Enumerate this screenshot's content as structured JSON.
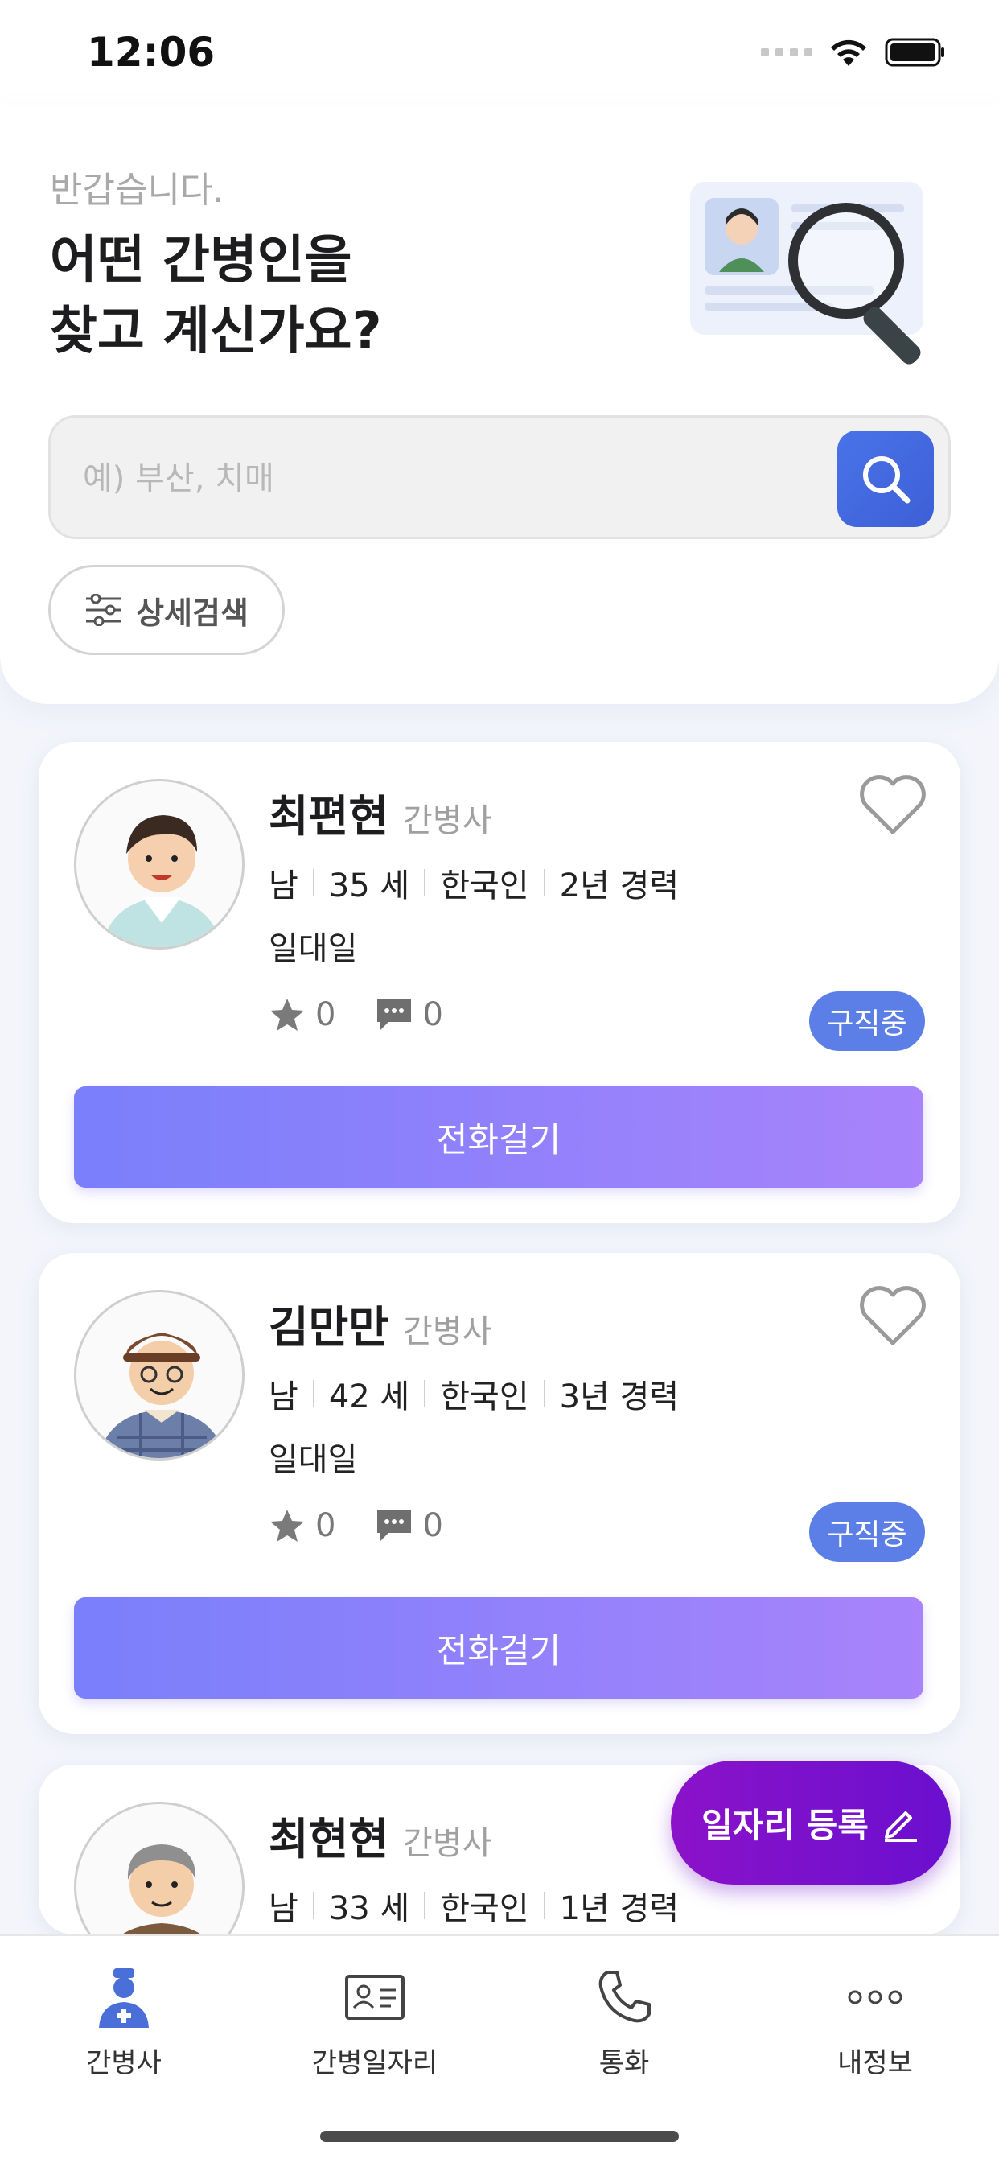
{
  "status_bar": {
    "time": "12:06"
  },
  "header": {
    "greeting": "반갑습니다.",
    "headline": "어떤 간병인을\n찾고 계신가요?",
    "search_placeholder": "예) 부산, 치매",
    "detail_search_label": "상세검색"
  },
  "caregivers": [
    {
      "name": "최편현",
      "role": "간병사",
      "gender": "남",
      "age": "35 세",
      "nationality": "한국인",
      "experience": "2년 경력",
      "care_type": "일대일",
      "rating": "0",
      "reviews": "0",
      "status": "구직중",
      "call_label": "전화걸기"
    },
    {
      "name": "김만만",
      "role": "간병사",
      "gender": "남",
      "age": "42 세",
      "nationality": "한국인",
      "experience": "3년 경력",
      "care_type": "일대일",
      "rating": "0",
      "reviews": "0",
      "status": "구직중",
      "call_label": "전화걸기"
    },
    {
      "name": "최현현",
      "role": "간병사",
      "gender": "남",
      "age": "33 세",
      "nationality": "한국인",
      "experience": "1년 경력"
    }
  ],
  "fab": {
    "label": "일자리 등록"
  },
  "tab_bar": {
    "items": [
      {
        "label": "간병사",
        "icon": "nurse-icon",
        "active": true
      },
      {
        "label": "간병일자리",
        "icon": "id-card-icon"
      },
      {
        "label": "통화",
        "icon": "phone-icon"
      },
      {
        "label": "내정보",
        "icon": "more-icon"
      }
    ]
  },
  "colors": {
    "accent_blue": "#4a73e8",
    "badge_blue": "#5b7fe6",
    "call_gradient_start": "#7a7ffb",
    "call_gradient_end": "#a883fb",
    "fab_purple": "#8b12c9"
  }
}
